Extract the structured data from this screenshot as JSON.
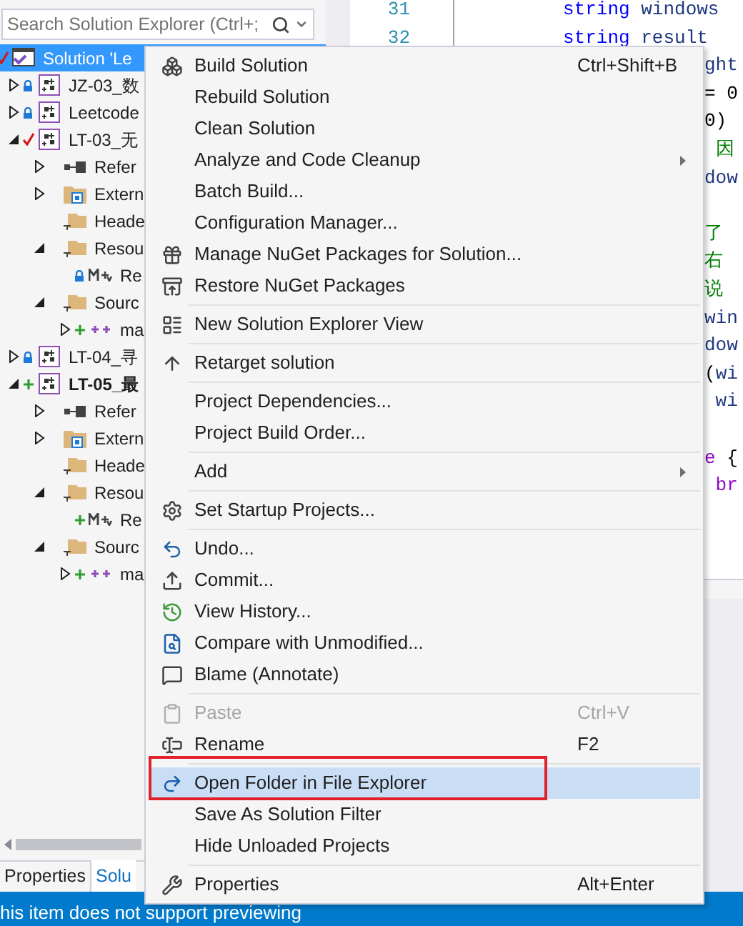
{
  "solution_explorer": {
    "search": {
      "placeholder": "Search Solution Explorer (Ctrl+;"
    },
    "tree": [
      {
        "label": "Solution 'Le",
        "kind": "solution",
        "checked_out": true,
        "selected": true,
        "children": [
          {
            "label": "JZ-03_数",
            "kind": "project",
            "locked": true,
            "expanded": false,
            "selected": false,
            "startup": false
          },
          {
            "label": "Leetcode",
            "kind": "project",
            "locked": true,
            "expanded": false,
            "selected": false,
            "startup": false
          },
          {
            "label": "LT-03_无",
            "kind": "project",
            "checked_out": true,
            "expanded": true,
            "selected": false,
            "startup": false,
            "children": [
              {
                "label": "Refer",
                "kind": "references",
                "expanded": false,
                "selected": false
              },
              {
                "label": "Extern",
                "kind": "external",
                "expanded": false,
                "selected": false
              },
              {
                "label": "Heade",
                "kind": "filter",
                "selected": false
              },
              {
                "label": "Resou",
                "kind": "filter",
                "expanded": true,
                "selected": false,
                "children": [
                  {
                    "label": "Re",
                    "kind": "resource",
                    "locked": true,
                    "selected": false
                  }
                ]
              },
              {
                "label": "Sourc",
                "kind": "filter",
                "expanded": true,
                "selected": false,
                "children": [
                  {
                    "label": "ma",
                    "kind": "source",
                    "added": true,
                    "expanded": false,
                    "selected": false
                  }
                ]
              }
            ]
          },
          {
            "label": "LT-04_寻",
            "kind": "project",
            "locked": true,
            "expanded": false,
            "selected": false,
            "startup": false
          },
          {
            "label": "LT-05_最",
            "kind": "project",
            "added": true,
            "expanded": true,
            "selected": false,
            "startup": true,
            "children": [
              {
                "label": "Refer",
                "kind": "references",
                "expanded": false,
                "selected": false
              },
              {
                "label": "Extern",
                "kind": "external",
                "expanded": false,
                "selected": false
              },
              {
                "label": "Heade",
                "kind": "filter",
                "selected": false
              },
              {
                "label": "Resou",
                "kind": "filter",
                "expanded": true,
                "selected": false,
                "children": [
                  {
                    "label": "Re",
                    "kind": "resource",
                    "added": true,
                    "selected": false
                  }
                ]
              },
              {
                "label": "Sourc",
                "kind": "filter",
                "expanded": true,
                "selected": false,
                "children": [
                  {
                    "label": "ma",
                    "kind": "source",
                    "added": true,
                    "expanded": false,
                    "selected": false
                  }
                ]
              }
            ]
          }
        ]
      }
    ],
    "tabs": [
      {
        "label": "Properties",
        "selected": false
      },
      {
        "label": "Solu",
        "selected": true
      }
    ]
  },
  "editor": {
    "lines": [
      {
        "kind": "code",
        "number": "31",
        "tokens": [
          {
            "kind": "keyword",
            "text": "string"
          },
          {
            "kind": "ident",
            "text": " windows"
          }
        ]
      },
      {
        "kind": "code",
        "number": "32",
        "tokens": [
          {
            "kind": "keyword",
            "text": "string"
          },
          {
            "kind": "ident",
            "text": " result"
          }
        ]
      },
      {
        "kind": "code",
        "tokens": [
          {
            "kind": "ident",
            "text": "ght"
          }
        ]
      },
      {
        "kind": "code",
        "tokens": [
          {
            "kind": "plain",
            "text": "= 0"
          }
        ]
      },
      {
        "kind": "code",
        "tokens": [
          {
            "kind": "plain",
            "text": "0)"
          }
        ]
      },
      {
        "kind": "code",
        "tokens": [
          {
            "kind": "comment",
            "text": " 因"
          }
        ]
      },
      {
        "kind": "code",
        "tokens": [
          {
            "kind": "ident",
            "text": "dow"
          }
        ]
      },
      {
        "kind": "blank"
      },
      {
        "kind": "code",
        "tokens": [
          {
            "kind": "comment",
            "text": "了"
          }
        ]
      },
      {
        "kind": "code",
        "tokens": [
          {
            "kind": "comment",
            "text": "右"
          }
        ]
      },
      {
        "kind": "code",
        "tokens": [
          {
            "kind": "comment",
            "text": "说"
          }
        ]
      },
      {
        "kind": "code",
        "tokens": [
          {
            "kind": "ident",
            "text": "win"
          }
        ]
      },
      {
        "kind": "code",
        "tokens": [
          {
            "kind": "ident",
            "text": "dow"
          }
        ]
      },
      {
        "kind": "code",
        "tokens": [
          {
            "kind": "plain",
            "text": "("
          },
          {
            "kind": "ident",
            "text": "wi"
          }
        ]
      },
      {
        "kind": "code",
        "tokens": [
          {
            "kind": "ident",
            "text": " wi"
          }
        ]
      },
      {
        "kind": "blank"
      },
      {
        "kind": "code",
        "tokens": [
          {
            "kind": "control",
            "text": "e"
          },
          {
            "kind": "plain",
            "text": " {"
          }
        ]
      },
      {
        "kind": "code",
        "tokens": [
          {
            "kind": "control",
            "text": " br"
          }
        ]
      }
    ]
  },
  "context_menu": {
    "items": [
      {
        "kind": "command",
        "label": "Build Solution",
        "shortcut": "Ctrl+Shift+B",
        "disabled": false,
        "selected": false
      },
      {
        "kind": "command",
        "label": "Rebuild Solution",
        "disabled": false,
        "selected": false
      },
      {
        "kind": "command",
        "label": "Clean Solution",
        "disabled": false,
        "selected": false
      },
      {
        "kind": "submenu",
        "label": "Analyze and Code Cleanup",
        "disabled": false,
        "selected": false
      },
      {
        "kind": "command",
        "label": "Batch Build...",
        "disabled": false,
        "selected": false
      },
      {
        "kind": "command",
        "label": "Configuration Manager...",
        "disabled": false,
        "selected": false
      },
      {
        "kind": "command",
        "label": "Manage NuGet Packages for Solution...",
        "disabled": false,
        "selected": false
      },
      {
        "kind": "command",
        "label": "Restore NuGet Packages",
        "disabled": false,
        "selected": false
      },
      {
        "kind": "separator"
      },
      {
        "kind": "command",
        "label": "New Solution Explorer View",
        "disabled": false,
        "selected": false
      },
      {
        "kind": "separator"
      },
      {
        "kind": "command",
        "label": "Retarget solution",
        "disabled": false,
        "selected": false
      },
      {
        "kind": "separator"
      },
      {
        "kind": "command",
        "label": "Project Dependencies...",
        "disabled": false,
        "selected": false
      },
      {
        "kind": "command",
        "label": "Project Build Order...",
        "disabled": false,
        "selected": false
      },
      {
        "kind": "separator"
      },
      {
        "kind": "submenu",
        "label": "Add",
        "disabled": false,
        "selected": false
      },
      {
        "kind": "separator"
      },
      {
        "kind": "command",
        "label": "Set Startup Projects...",
        "disabled": false,
        "selected": false
      },
      {
        "kind": "separator"
      },
      {
        "kind": "command",
        "label": "Undo...",
        "disabled": false,
        "selected": false
      },
      {
        "kind": "command",
        "label": "Commit...",
        "disabled": false,
        "selected": false
      },
      {
        "kind": "command",
        "label": "View History...",
        "disabled": false,
        "selected": false
      },
      {
        "kind": "command",
        "label": "Compare with Unmodified...",
        "disabled": false,
        "selected": false
      },
      {
        "kind": "command",
        "label": "Blame (Annotate)",
        "disabled": false,
        "selected": false
      },
      {
        "kind": "separator"
      },
      {
        "kind": "command",
        "label": "Paste",
        "shortcut": "Ctrl+V",
        "disabled": true,
        "selected": false
      },
      {
        "kind": "command",
        "label": "Rename",
        "shortcut": "F2",
        "disabled": false,
        "selected": false
      },
      {
        "kind": "separator"
      },
      {
        "kind": "command",
        "label": "Open Folder in File Explorer",
        "disabled": false,
        "selected": true,
        "framed": true
      },
      {
        "kind": "command",
        "label": "Save As Solution Filter",
        "disabled": false,
        "selected": false
      },
      {
        "kind": "command",
        "label": "Hide Unloaded Projects",
        "disabled": false,
        "selected": false
      },
      {
        "kind": "separator"
      },
      {
        "kind": "command",
        "label": "Properties",
        "shortcut": "Alt+Enter",
        "disabled": false,
        "selected": false
      }
    ]
  },
  "status_bar": {
    "text": "his item does not support previewing"
  }
}
